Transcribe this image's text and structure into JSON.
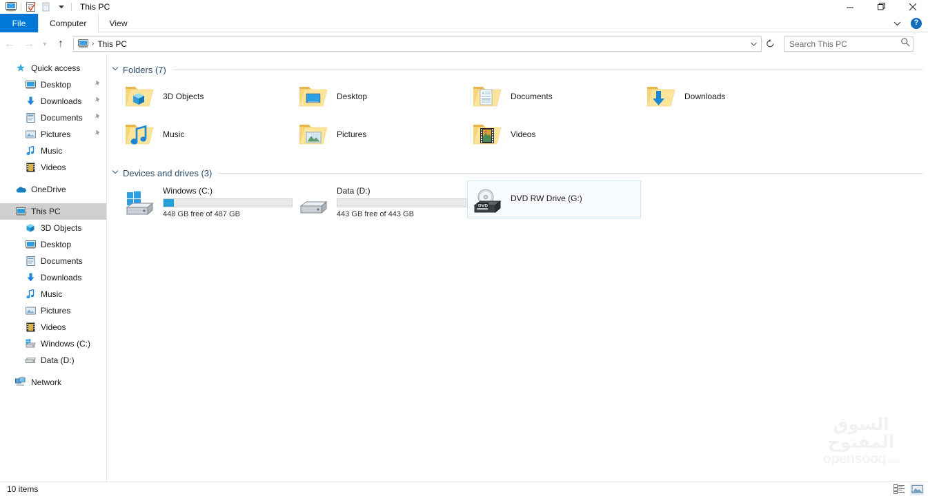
{
  "window": {
    "title": "This PC",
    "quick_access_toolbar": [
      {
        "name": "this-pc-icon",
        "label": "This PC"
      },
      {
        "name": "properties-icon",
        "label": "Properties"
      },
      {
        "name": "new-folder-icon",
        "label": "New folder"
      },
      {
        "name": "customize-qat-chevron-icon",
        "label": "Customize Quick Access Toolbar"
      }
    ],
    "controls": {
      "minimize": "Minimize",
      "restore": "Restore",
      "close": "Close"
    }
  },
  "ribbon": {
    "tabs": [
      {
        "label": "File",
        "active": false,
        "style": "file"
      },
      {
        "label": "Computer",
        "active": true,
        "style": "normal"
      },
      {
        "label": "View",
        "active": false,
        "style": "normal"
      }
    ],
    "expand_label": "Expand the Ribbon",
    "help_label": "?"
  },
  "address_bar": {
    "back_label": "Back",
    "forward_label": "Forward",
    "recent_label": "Recent locations",
    "up_label": "Up",
    "breadcrumb_icon": "this-pc-icon",
    "breadcrumb_separator": "›",
    "breadcrumb_text": "This PC",
    "dropdown_label": "Previous locations",
    "refresh_label": "Refresh"
  },
  "search": {
    "placeholder": "Search This PC",
    "icon": "search-icon"
  },
  "sidebar": {
    "groups": [
      {
        "header": {
          "label": "Quick access",
          "icon": "star-pin-icon",
          "level": 0
        },
        "items": [
          {
            "label": "Desktop",
            "icon": "desktop-icon",
            "pinned": true,
            "level": 1
          },
          {
            "label": "Downloads",
            "icon": "downloads-icon",
            "pinned": true,
            "level": 1
          },
          {
            "label": "Documents",
            "icon": "documents-icon",
            "pinned": true,
            "level": 1
          },
          {
            "label": "Pictures",
            "icon": "pictures-icon",
            "pinned": true,
            "level": 1
          },
          {
            "label": "Music",
            "icon": "music-icon",
            "pinned": false,
            "level": 1
          },
          {
            "label": "Videos",
            "icon": "videos-icon",
            "pinned": false,
            "level": 1
          }
        ]
      },
      {
        "header": {
          "label": "OneDrive",
          "icon": "onedrive-cloud-icon",
          "level": 0
        },
        "items": []
      },
      {
        "header": {
          "label": "This PC",
          "icon": "this-pc-icon",
          "level": 0,
          "selected": true
        },
        "items": [
          {
            "label": "3D Objects",
            "icon": "3d-objects-icon",
            "pinned": false,
            "level": 1
          },
          {
            "label": "Desktop",
            "icon": "desktop-icon",
            "pinned": false,
            "level": 1
          },
          {
            "label": "Documents",
            "icon": "documents-icon",
            "pinned": false,
            "level": 1
          },
          {
            "label": "Downloads",
            "icon": "downloads-icon",
            "pinned": false,
            "level": 1
          },
          {
            "label": "Music",
            "icon": "music-icon",
            "pinned": false,
            "level": 1
          },
          {
            "label": "Pictures",
            "icon": "pictures-icon",
            "pinned": false,
            "level": 1
          },
          {
            "label": "Videos",
            "icon": "videos-icon",
            "pinned": false,
            "level": 1
          },
          {
            "label": "Windows (C:)",
            "icon": "windows-drive-icon",
            "pinned": false,
            "level": 1
          },
          {
            "label": "Data (D:)",
            "icon": "hard-drive-icon",
            "pinned": false,
            "level": 1
          }
        ]
      },
      {
        "header": {
          "label": "Network",
          "icon": "network-icon",
          "level": 0
        },
        "items": []
      }
    ]
  },
  "content": {
    "groups": [
      {
        "title": "Folders (7)",
        "expanded": true,
        "kind": "folders",
        "items": [
          {
            "name": "3D Objects",
            "icon": "folder-3d-objects-icon"
          },
          {
            "name": "Desktop",
            "icon": "folder-desktop-icon"
          },
          {
            "name": "Documents",
            "icon": "folder-documents-icon"
          },
          {
            "name": "Downloads",
            "icon": "folder-downloads-icon"
          },
          {
            "name": "Music",
            "icon": "folder-music-icon"
          },
          {
            "name": "Pictures",
            "icon": "folder-pictures-icon"
          },
          {
            "name": "Videos",
            "icon": "folder-videos-icon"
          }
        ]
      },
      {
        "title": "Devices and drives (3)",
        "expanded": true,
        "kind": "drives",
        "items": [
          {
            "name": "Windows (C:)",
            "icon": "windows-drive-icon",
            "has_bar": true,
            "used_percent": 8,
            "capacity_text": "448 GB free of 487 GB",
            "focused": false
          },
          {
            "name": "Data (D:)",
            "icon": "hard-drive-icon",
            "has_bar": true,
            "used_percent": 0,
            "capacity_text": "443 GB free of 443 GB",
            "focused": false
          },
          {
            "name": "DVD RW Drive (G:)",
            "icon": "dvd-drive-icon",
            "has_bar": false,
            "used_percent": 0,
            "capacity_text": "",
            "focused": true
          }
        ]
      }
    ]
  },
  "status_bar": {
    "item_count_text": "10 items",
    "views": [
      {
        "name": "details-view-icon",
        "label": "Details view",
        "active": false
      },
      {
        "name": "large-icons-view-icon",
        "label": "Large icons view",
        "active": true
      }
    ]
  },
  "watermark": {
    "arabic": "السوق المفتوح",
    "english": "opensooq",
    "tld": ".com"
  },
  "colors": {
    "file_tab_blue": "#0078d7",
    "group_header_blue": "#2a4a6b",
    "progress_blue": "#26a0da",
    "selection_gray": "#cfcfcf",
    "focus_border_blue": "#cce3f7",
    "help_blue": "#0f6cbd"
  }
}
